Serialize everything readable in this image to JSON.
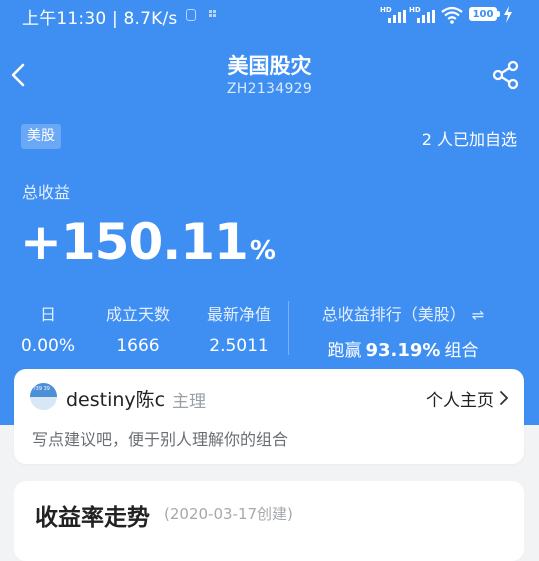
{
  "status_bar": {
    "time": "上午11:30 | 8.7K/s",
    "network_hd_1": "HD",
    "network_hd_2": "HD",
    "battery": "100"
  },
  "nav": {
    "title": "美国股灾",
    "portfolio_id": "ZH2134929"
  },
  "market_badge": "美股",
  "followers": "2 人已加自选",
  "total_return": {
    "label": "总收益",
    "value": "+150.11",
    "unit": "%"
  },
  "stats": [
    {
      "label": "日",
      "value": "0.00%"
    },
    {
      "label": "成立天数",
      "value": "1666"
    },
    {
      "label": "最新净值",
      "value": "2.5011"
    }
  ],
  "ranking": {
    "label": "总收益排行（美股）",
    "swap_icon": "⇌",
    "prefix": "跑赢",
    "percent": "93.19%",
    "suffix": "组合"
  },
  "manager_card": {
    "avatar_text": "?39 39",
    "name": "destiny陈c",
    "role": "主理",
    "homepage_link": "个人主页",
    "suggestion": "写点建议吧，便于别人理解你的组合"
  },
  "returns_card": {
    "title": "收益率走势",
    "created_date": "(2020-03-17创建)"
  },
  "colors": {
    "primary": "#3f8ff3",
    "card": "#ffffff",
    "page_bg": "#f2f3f5"
  }
}
